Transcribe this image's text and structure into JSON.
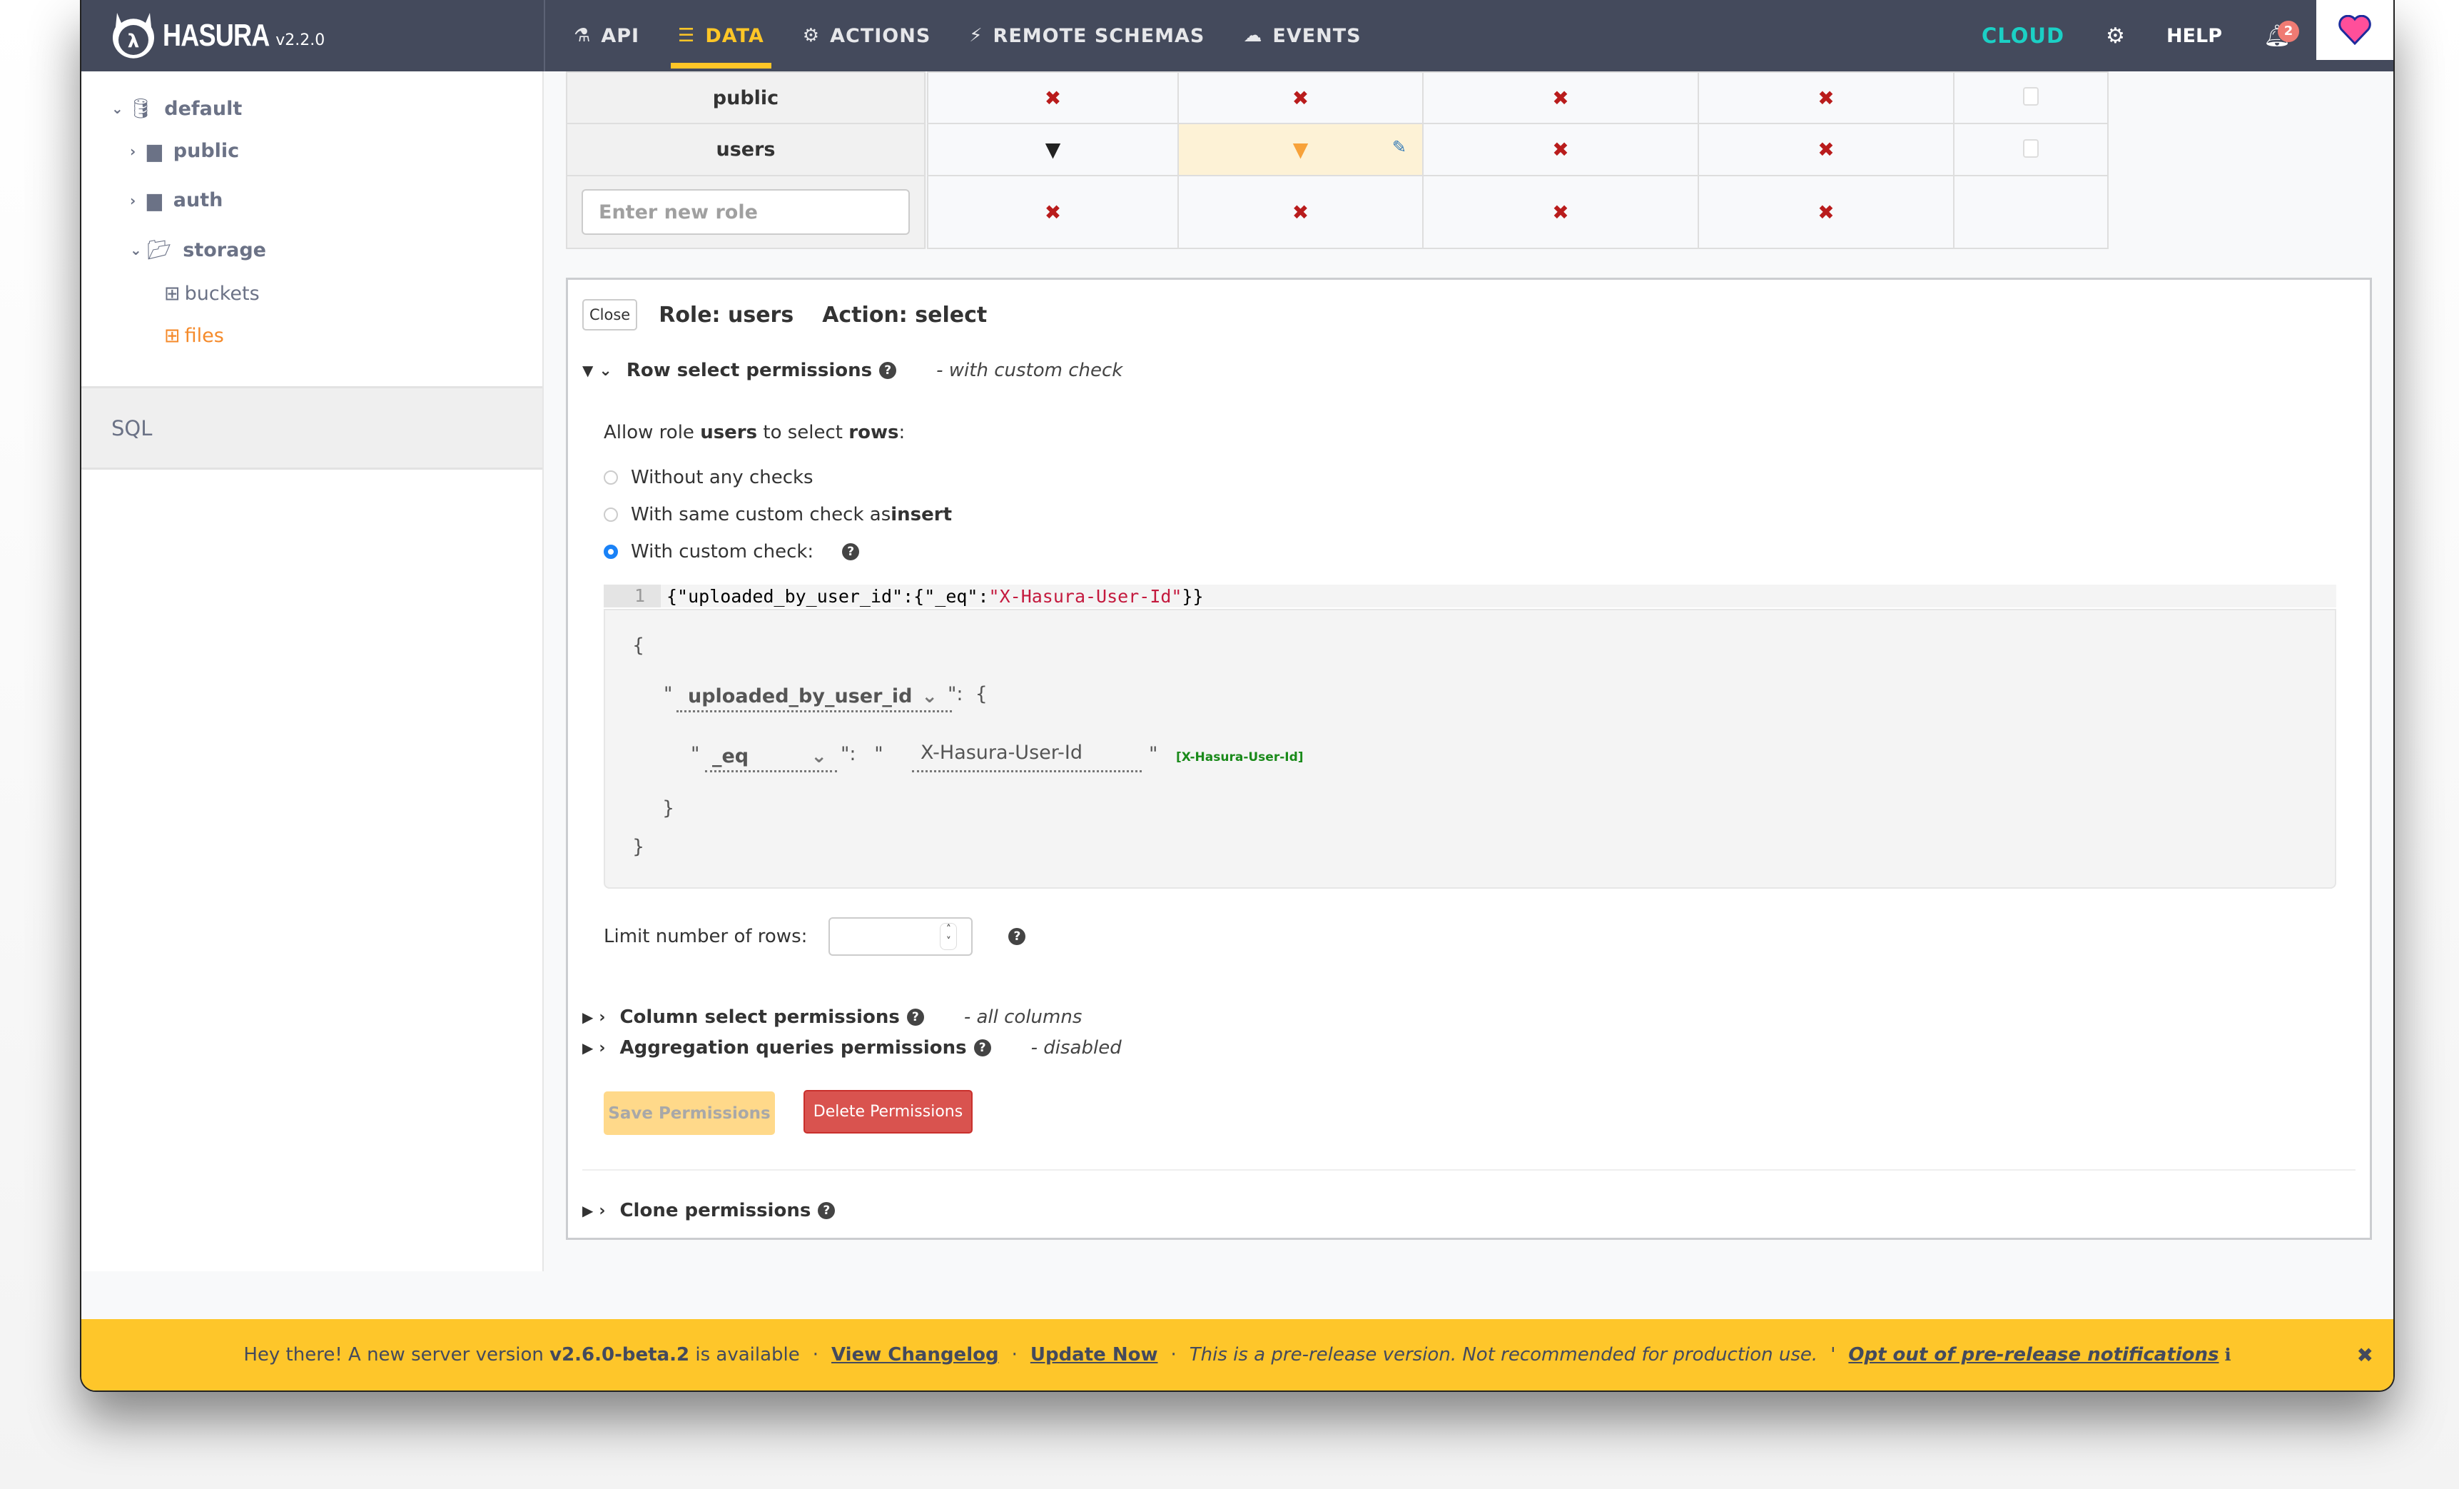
{
  "header": {
    "brand": "HASURA",
    "version": "v2.2.0",
    "nav": [
      {
        "label": "API",
        "icon": "flask-icon"
      },
      {
        "label": "DATA",
        "icon": "database-icon",
        "active": true
      },
      {
        "label": "ACTIONS",
        "icon": "cogs-icon"
      },
      {
        "label": "REMOTE SCHEMAS",
        "icon": "plug-icon"
      },
      {
        "label": "EVENTS",
        "icon": "cloud-icon"
      }
    ],
    "cloud": "CLOUD",
    "help": "HELP",
    "notification_count": "2",
    "colors": {
      "bg": "#444a5c",
      "accent": "#ffc627",
      "cloud": "#1bd0c5"
    }
  },
  "sidebar": {
    "database": "default",
    "schemas": [
      {
        "name": "public",
        "expanded": false
      },
      {
        "name": "auth",
        "expanded": false
      },
      {
        "name": "storage",
        "expanded": true,
        "tables": [
          {
            "name": "buckets",
            "active": false
          },
          {
            "name": "files",
            "active": true
          }
        ]
      }
    ],
    "sql": "SQL"
  },
  "permissions_table": {
    "rows": [
      {
        "role": "public",
        "cells": [
          "none",
          "none",
          "none",
          "none",
          "checkbox"
        ]
      },
      {
        "role": "users",
        "cells": [
          "partial",
          "partial-selected",
          "none",
          "none",
          "checkbox"
        ]
      },
      {
        "role_input_placeholder": "Enter new role",
        "cells": [
          "none",
          "none",
          "none",
          "none",
          "empty"
        ]
      }
    ]
  },
  "editor": {
    "close": "Close",
    "role_title": "Role: users",
    "action_title": "Action: select",
    "row_section": {
      "title": "Row select permissions",
      "note": "- with custom check",
      "allow_prefix": "Allow role ",
      "allow_role": "users",
      "allow_mid": " to select ",
      "allow_obj": "rows",
      "allow_suffix": ":",
      "options": [
        {
          "label": "Without any checks",
          "selected": false
        },
        {
          "label": "With same custom check as ",
          "bold": "insert",
          "selected": false
        },
        {
          "label": "With custom check:",
          "selected": true
        }
      ],
      "code_line_number": "1",
      "code_prefix": "{\"uploaded_by_user_id\":{\"_eq\":",
      "code_string": "\"X-Hasura-User-Id\"",
      "code_suffix": "}}",
      "builder": {
        "open_brace": "{",
        "close_brace": "}",
        "column": "uploaded_by_user_id",
        "operator": "_eq",
        "value": "X-Hasura-User-Id",
        "session_var": "[X-Hasura-User-Id]"
      }
    },
    "limit_label": "Limit number of rows:",
    "limit_value": "",
    "collapsed_sections": [
      {
        "title": "Column select permissions",
        "note": "- all columns"
      },
      {
        "title": "Aggregation queries permissions",
        "note": "- disabled"
      }
    ],
    "save": "Save Permissions",
    "delete": "Delete Permissions",
    "clone": "Clone permissions"
  },
  "banner": {
    "prefix": "Hey there! A new server version ",
    "version": "v2.6.0-beta.2",
    "suffix": " is available",
    "changelog": "View Changelog",
    "update": "Update Now",
    "warning": "This is a pre-release version. Not recommended for production use.",
    "opt_out": "Opt out of pre-release notifications",
    "color": "#fec62a"
  }
}
